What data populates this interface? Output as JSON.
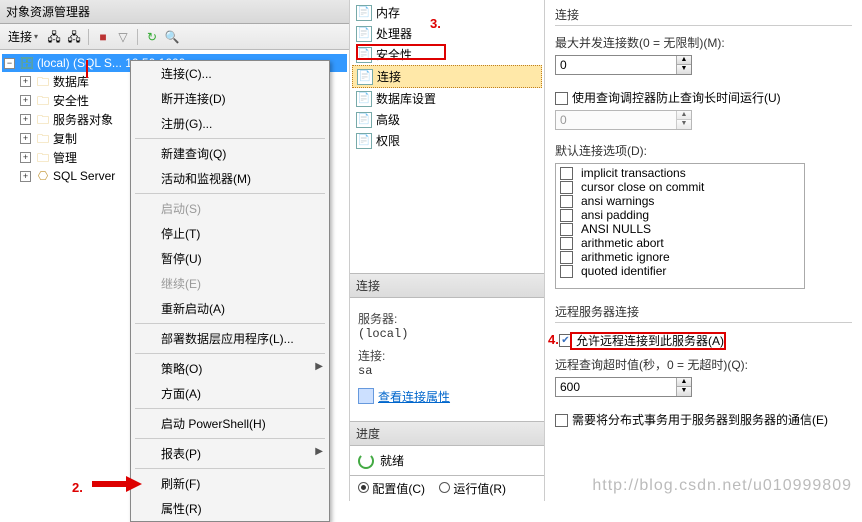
{
  "left": {
    "title": "对象资源管理器",
    "toolbar": {
      "connect_label": "连接"
    },
    "root": {
      "label": "(local) (SQL S...          10.50.1600"
    },
    "children": [
      {
        "label": "数据库"
      },
      {
        "label": "安全性"
      },
      {
        "label": "服务器对象"
      },
      {
        "label": "复制"
      },
      {
        "label": "管理"
      },
      {
        "label": "SQL Server"
      }
    ]
  },
  "context_menu": {
    "connect": "连接(C)...",
    "disconnect": "断开连接(D)",
    "register": "注册(G)...",
    "new_query": "新建查询(Q)",
    "activity_monitor": "活动和监视器(M)",
    "start": "启动(S)",
    "stop": "停止(T)",
    "pause": "暂停(U)",
    "resume": "继续(E)",
    "restart": "重新启动(A)",
    "deploy": "部署数据层应用程序(L)...",
    "policy": "策略(O)",
    "facets": "方面(A)",
    "powershell": "启动 PowerShell(H)",
    "reports": "报表(P)",
    "refresh": "刷新(F)",
    "properties": "属性(R)"
  },
  "nav": {
    "memory": "内存",
    "processor": "处理器",
    "security": "安全性",
    "connections": "连接",
    "dbsettings": "数据库设置",
    "advanced": "高级",
    "permissions": "权限"
  },
  "mid": {
    "conn_hdr": "连接",
    "server_lbl": "服务器:",
    "server_val": "(local)",
    "conn_lbl": "连接:",
    "conn_val": "sa",
    "view_props": "查看连接属性",
    "progress_hdr": "进度",
    "ready": "就绪"
  },
  "bottom": {
    "opt_config": "配置值(C)",
    "opt_running": "运行值(R)"
  },
  "right": {
    "group_conn": "连接",
    "max_conn_lbl": "最大并发连接数(0 = 无限制)(M):",
    "max_conn_val": "0",
    "use_governor": "使用查询调控器防止查询长时间运行(U)",
    "governor_val": "0",
    "default_opts_lbl": "默认连接选项(D):",
    "opts": [
      "implicit transactions",
      "cursor close on commit",
      "ansi warnings",
      "ansi padding",
      "ANSI NULLS",
      "arithmetic abort",
      "arithmetic ignore",
      "quoted identifier"
    ],
    "group_remote": "远程服务器连接",
    "allow_remote": "允许远程连接到此服务器(A)",
    "remote_timeout_lbl": "远程查询超时值(秒，0 = 无超时)(Q):",
    "remote_timeout_val": "600",
    "dist_trans": "需要将分布式事务用于服务器到服务器的通信(E)"
  },
  "annotations": {
    "n2": "2.",
    "n3": "3.",
    "n4": "4."
  },
  "watermark": "http://blog.csdn.net/u010999809"
}
